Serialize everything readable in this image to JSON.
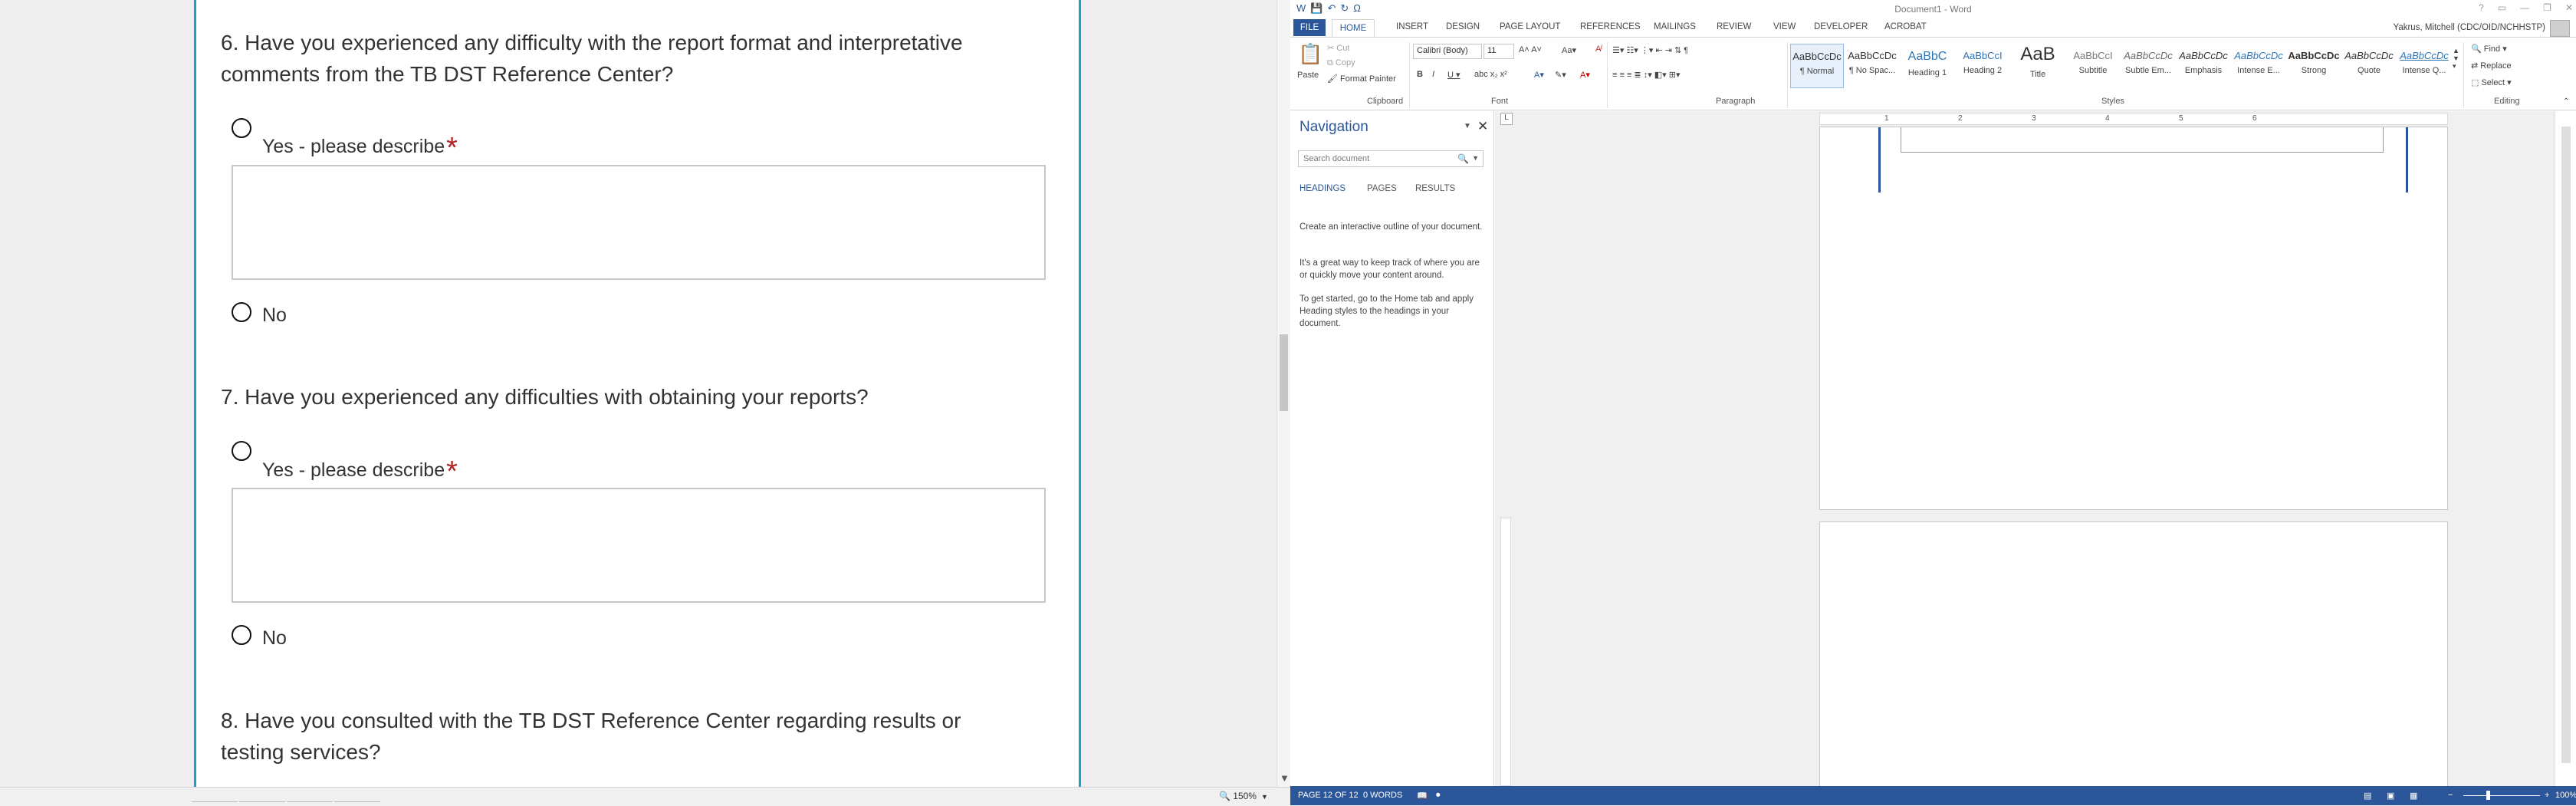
{
  "survey": {
    "q6": {
      "text": "6. Have you experienced any difficulty with the report format and interpretative comments from the TB DST Reference Center?",
      "yes_label": "Yes - please describe",
      "required_mark": "*",
      "no_label": "No"
    },
    "q7": {
      "text": "7. Have you experienced any difficulties with obtaining your reports?",
      "yes_label": "Yes - please describe",
      "required_mark": "*",
      "no_label": "No"
    },
    "q8": {
      "text": "8. Have you consulted with the TB DST Reference Center regarding results or testing services?"
    }
  },
  "browser_status": {
    "zoom": "150%"
  },
  "word": {
    "title": "Document1 - Word",
    "user": "Yakrus, Mitchell (CDC/OID/NCHHSTP)",
    "tabs": [
      "FILE",
      "HOME",
      "INSERT",
      "DESIGN",
      "PAGE LAYOUT",
      "REFERENCES",
      "MAILINGS",
      "REVIEW",
      "VIEW",
      "DEVELOPER",
      "ACROBAT"
    ],
    "clipboard": {
      "paste": "Paste",
      "cut": "Cut",
      "copy": "Copy",
      "format_painter": "Format Painter",
      "label": "Clipboard"
    },
    "font": {
      "name": "Calibri (Body)",
      "size": "11",
      "label": "Font"
    },
    "paragraph": {
      "label": "Paragraph"
    },
    "styles": {
      "label": "Styles",
      "items": [
        {
          "sample": "AaBbCcDc",
          "name": "¶ Normal"
        },
        {
          "sample": "AaBbCcDc",
          "name": "¶ No Spac..."
        },
        {
          "sample": "AaBbC",
          "name": "Heading 1"
        },
        {
          "sample": "AaBbCcI",
          "name": "Heading 2"
        },
        {
          "sample": "AaB",
          "name": "Title"
        },
        {
          "sample": "AaBbCcI",
          "name": "Subtitle"
        },
        {
          "sample": "AaBbCcDc",
          "name": "Subtle Em..."
        },
        {
          "sample": "AaBbCcDc",
          "name": "Emphasis"
        },
        {
          "sample": "AaBbCcDc",
          "name": "Intense E..."
        },
        {
          "sample": "AaBbCcDc",
          "name": "Strong"
        },
        {
          "sample": "AaBbCcDc",
          "name": "Quote"
        },
        {
          "sample": "AaBbCcDc",
          "name": "Intense Q..."
        }
      ]
    },
    "editing": {
      "find": "Find",
      "replace": "Replace",
      "select": "Select",
      "label": "Editing"
    },
    "navigation": {
      "title": "Navigation",
      "search_placeholder": "Search document",
      "tabs": [
        "HEADINGS",
        "PAGES",
        "RESULTS"
      ],
      "help": [
        "Create an interactive outline of your document.",
        "It's a great way to keep track of where you are or quickly move your content around.",
        "To get started, go to the Home tab and apply Heading styles to the headings in your document."
      ]
    },
    "ruler_numbers": [
      "1",
      "2",
      "3",
      "4",
      "5",
      "6"
    ],
    "status": {
      "page": "PAGE 12 OF 12",
      "words": "0 WORDS",
      "zoom": "100%"
    }
  }
}
